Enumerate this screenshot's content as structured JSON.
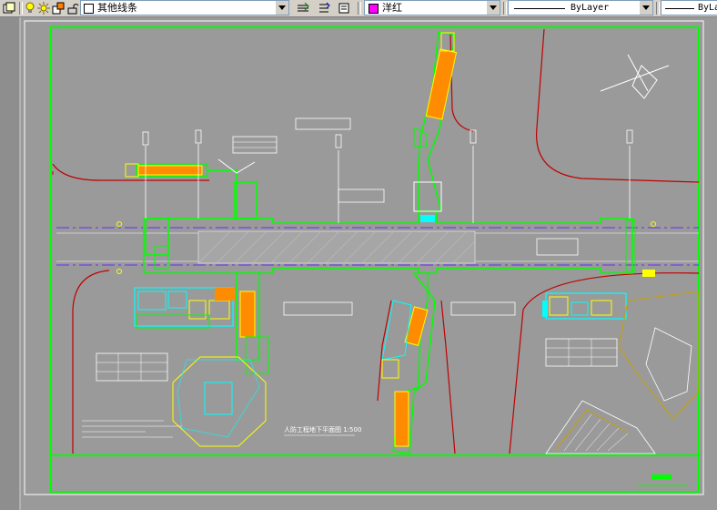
{
  "toolbar": {
    "linetype_label": "其他线条",
    "color_label": "洋红",
    "color_swatch": "#ff00ff",
    "linetype_combo": "ByLayer",
    "lineweight_combo": "ByLa"
  },
  "drawing": {
    "title_label": "人防工程地下平面图 1:500",
    "background": "#9a9a9a",
    "frame_color": "#00ff00"
  }
}
